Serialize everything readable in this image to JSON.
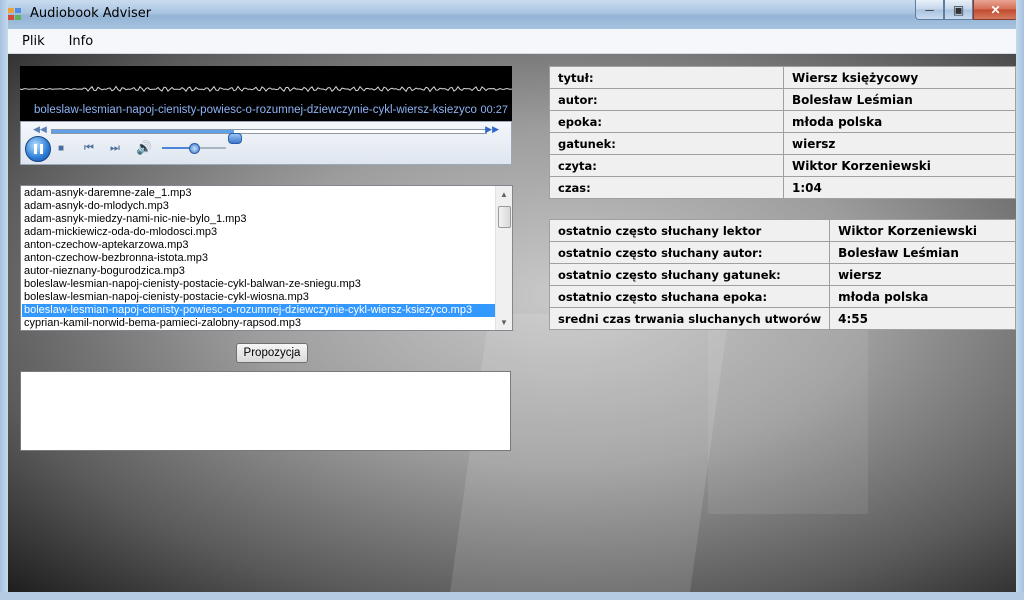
{
  "window": {
    "title": "Audiobook Adviser"
  },
  "menu": {
    "items": [
      "Plik",
      "Info"
    ]
  },
  "player": {
    "track_name": "boleslaw-lesmian-napoj-cienisty-powiesc-o-rozumnej-dziewczynie-cykl-wiersz-ksiezyco",
    "time": "00:27",
    "seek_fraction": 0.42,
    "volume_fraction": 0.5
  },
  "playlist": {
    "items": [
      "adam-asnyk-daremne-zale_1.mp3",
      "adam-asnyk-do-mlodych.mp3",
      "adam-asnyk-miedzy-nami-nic-nie-bylo_1.mp3",
      "adam-mickiewicz-oda-do-mlodosci.mp3",
      "anton-czechow-aptekarzowa.mp3",
      "anton-czechow-bezbronna-istota.mp3",
      "autor-nieznany-bogurodzica.mp3",
      "boleslaw-lesmian-napoj-cienisty-postacie-cykl-balwan-ze-sniegu.mp3",
      "boleslaw-lesmian-napoj-cienisty-postacie-cykl-wiosna.mp3",
      "boleslaw-lesmian-napoj-cienisty-powiesc-o-rozumnej-dziewczynie-cykl-wiersz-ksiezyco.mp3",
      "cyprian-kamil-norwid-bema-pamieci-zalobny-rapsod.mp3"
    ],
    "selected_index": 9
  },
  "propozycja_button": "Propozycja",
  "suggestion_text": "",
  "details": [
    {
      "key": "tytuł:",
      "value": "Wiersz księżycowy"
    },
    {
      "key": "autor:",
      "value": "Bolesław Leśmian"
    },
    {
      "key": "epoka:",
      "value": "młoda polska"
    },
    {
      "key": "gatunek:",
      "value": "wiersz"
    },
    {
      "key": "czyta:",
      "value": "Wiktor Korzeniewski"
    },
    {
      "key": "czas:",
      "value": "1:04"
    }
  ],
  "stats": [
    {
      "key": "ostatnio często słuchany lektor",
      "value": "Wiktor Korzeniewski"
    },
    {
      "key": "ostatnio często słuchany autor:",
      "value": "Bolesław Leśmian"
    },
    {
      "key": "ostatnio często słuchany gatunek:",
      "value": "wiersz"
    },
    {
      "key": "ostatnio często słuchana epoka:",
      "value": "młoda polska"
    },
    {
      "key": "sredni czas trwania sluchanych utworów",
      "value": "4:55"
    }
  ],
  "colors": {
    "titlebar": "#a9c4e0",
    "selection": "#3399ff",
    "player_text": "#8db4f5"
  }
}
